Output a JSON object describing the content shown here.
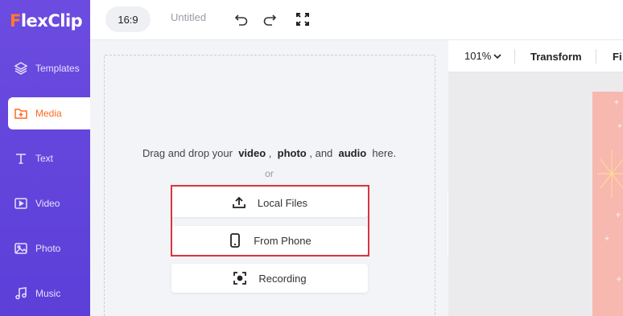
{
  "app": {
    "logo_first": "F",
    "logo_rest": "lexClip"
  },
  "sidebar": {
    "items": [
      {
        "label": "Templates",
        "icon": "layers-icon"
      },
      {
        "label": "Media",
        "icon": "media-folder-icon"
      },
      {
        "label": "Text",
        "icon": "text-icon"
      },
      {
        "label": "Video",
        "icon": "video-icon"
      },
      {
        "label": "Photo",
        "icon": "photo-icon"
      },
      {
        "label": "Music",
        "icon": "music-icon"
      }
    ],
    "active_index": 1
  },
  "topbar": {
    "ratio": "16:9",
    "title": "Untitled"
  },
  "upload": {
    "drag_prefix": "Drag and drop your",
    "video": "video",
    "sep1": ",",
    "photo": "photo",
    "sep2": ", and",
    "audio": "audio",
    "suffix": "here.",
    "or": "or",
    "local_files": "Local Files",
    "from_phone": "From Phone",
    "recording": "Recording"
  },
  "editor": {
    "zoom": "101%",
    "transform": "Transform",
    "filter_partial": "Fi"
  },
  "colors": {
    "sidebar": "#5b3fd8",
    "accent": "#ff6a1f",
    "highlight": "#d9363e"
  }
}
